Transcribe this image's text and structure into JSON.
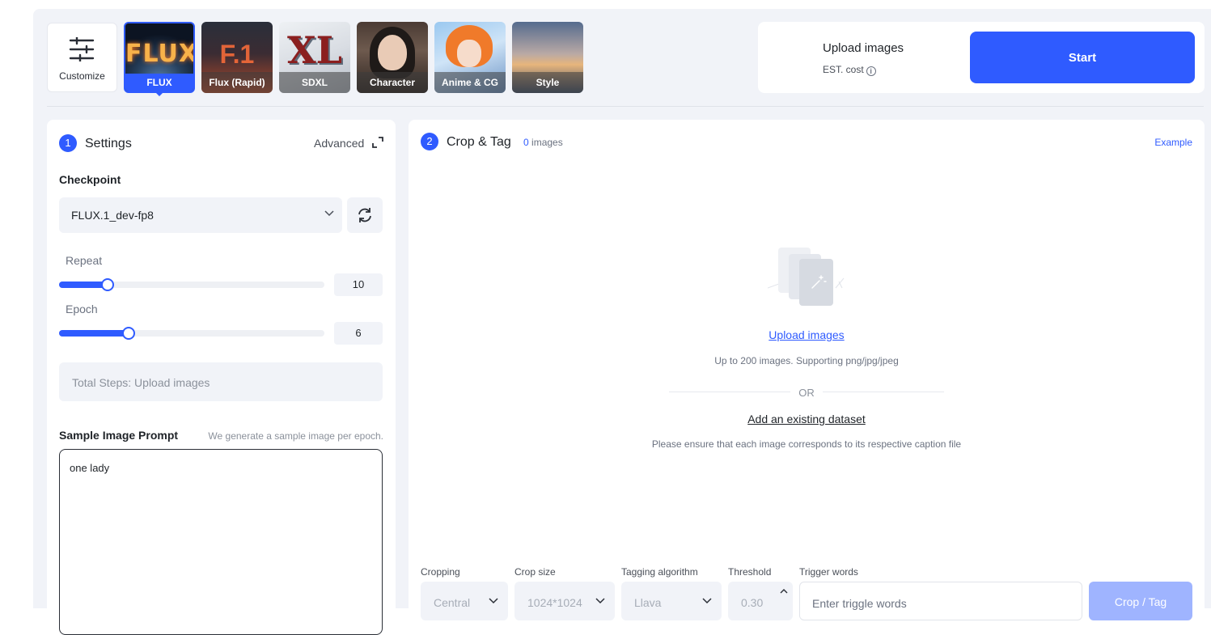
{
  "customize": {
    "label": "Customize",
    "icon": "sliders-icon"
  },
  "presets": [
    {
      "label": "FLUX",
      "art_text": "FLUX",
      "active": true
    },
    {
      "label": "Flux (Rapid)",
      "art_text": "F.1",
      "active": false
    },
    {
      "label": "SDXL",
      "art_text": "XL",
      "active": false
    },
    {
      "label": "Character",
      "active": false
    },
    {
      "label": "Anime & CG",
      "active": false
    },
    {
      "label": "Style",
      "active": false
    }
  ],
  "start_panel": {
    "title": "Upload images",
    "cost_label": "EST. cost",
    "info_icon": "info-icon",
    "start_label": "Start"
  },
  "settings": {
    "step": "1",
    "title": "Settings",
    "advanced_label": "Advanced",
    "expand_icon": "expand-icon",
    "checkpoint_label": "Checkpoint",
    "checkpoint_value": "FLUX.1_dev-fp8",
    "refresh_icon": "refresh-icon",
    "repeat": {
      "label": "Repeat",
      "value": "10",
      "fraction": 0.183
    },
    "epoch": {
      "label": "Epoch",
      "value": "6",
      "fraction": 0.262
    },
    "total_steps": "Total Steps: Upload images",
    "prompt_label": "Sample Image Prompt",
    "prompt_hint": "We generate a sample image per epoch.",
    "prompt_value": "one lady"
  },
  "crop_tag": {
    "step": "2",
    "title": "Crop & Tag",
    "image_count": "0",
    "image_count_suffix": "images",
    "example_label": "Example",
    "upload_link": "Upload images",
    "upload_hint": "Up to 200 images. Supporting png/jpg/jpeg",
    "or_text": "OR",
    "dataset_link": "Add an existing dataset",
    "dataset_hint": "Please ensure that each image corresponds to its respective caption file",
    "cropping": {
      "label": "Cropping",
      "value": "Central"
    },
    "crop_size": {
      "label": "Crop size",
      "value": "1024*1024"
    },
    "tagging": {
      "label": "Tagging algorithm",
      "value": "Llava"
    },
    "threshold": {
      "label": "Threshold",
      "value": "0.30"
    },
    "trigger": {
      "label": "Trigger words",
      "placeholder": "Enter triggle words"
    },
    "button_label": "Crop / Tag"
  },
  "colors": {
    "accent": "#2f5bff",
    "panel_bg": "#f1f3f8",
    "disabled_button": "#9fb4ff"
  }
}
